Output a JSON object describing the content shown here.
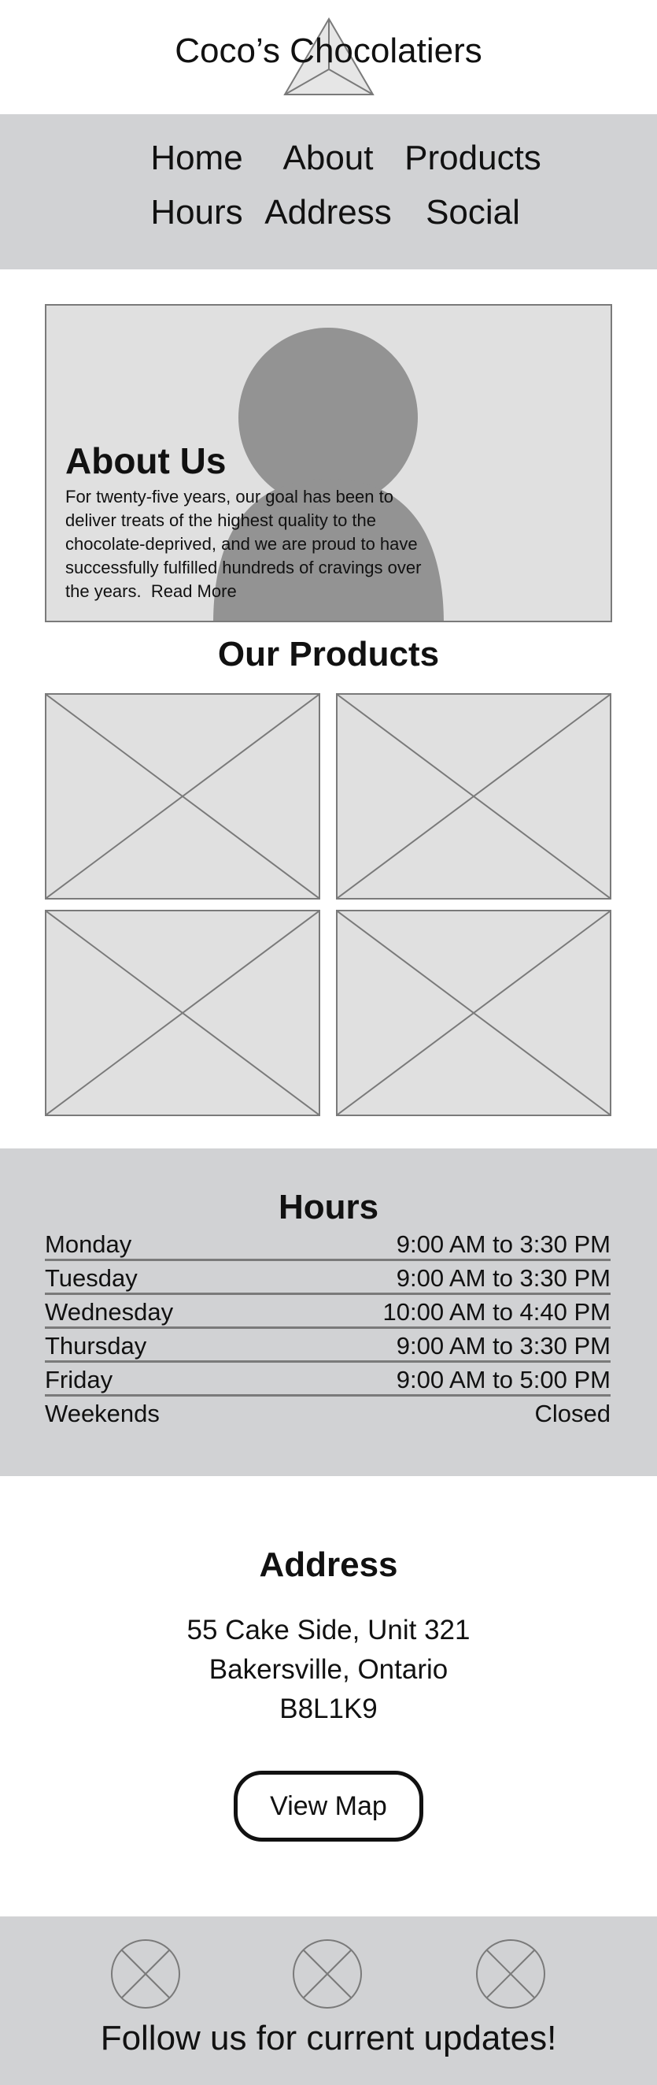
{
  "header": {
    "title": "Coco’s Chocolatiers",
    "logo_icon": "triangle-logo-icon"
  },
  "nav": {
    "items": [
      {
        "label": "Home"
      },
      {
        "label": "About"
      },
      {
        "label": "Products"
      },
      {
        "label": "Hours"
      },
      {
        "label": "Address"
      },
      {
        "label": "Social"
      }
    ]
  },
  "about": {
    "title": "About Us",
    "body": "For twenty-five years, our goal has been to deliver treats of the highest quality to the chocolate-deprived, and we are proud to have successfully fulfilled hundreds of cravings over the years.",
    "read_more": "Read More",
    "image_icon": "person-placeholder-icon"
  },
  "products": {
    "title": "Our Products",
    "items": [
      {
        "icon": "image-placeholder-icon"
      },
      {
        "icon": "image-placeholder-icon"
      },
      {
        "icon": "image-placeholder-icon"
      },
      {
        "icon": "image-placeholder-icon"
      }
    ]
  },
  "hours": {
    "title": "Hours",
    "rows": [
      {
        "day": "Monday",
        "time": "9:00 AM to 3:30 PM"
      },
      {
        "day": "Tuesday",
        "time": "9:00 AM to 3:30 PM"
      },
      {
        "day": "Wednesday",
        "time": "10:00 AM to 4:40 PM"
      },
      {
        "day": "Thursday",
        "time": "9:00 AM to 3:30 PM"
      },
      {
        "day": "Friday",
        "time": "9:00 AM to 5:00 PM"
      },
      {
        "day": "Weekends",
        "time": "Closed"
      }
    ]
  },
  "address": {
    "title": "Address",
    "lines": [
      "55 Cake Side, Unit 321",
      "Bakersville, Ontario",
      "B8L1K9"
    ],
    "map_button": "View Map"
  },
  "footer": {
    "social_icons": [
      "social-placeholder-icon",
      "social-placeholder-icon",
      "social-placeholder-icon"
    ],
    "text": "Follow us for current updates!"
  },
  "colors": {
    "band_gray": "#d1d2d4",
    "placeholder_fill": "#e0e0e0",
    "outline_gray": "#7a7a7a",
    "figure_gray": "#939393"
  }
}
